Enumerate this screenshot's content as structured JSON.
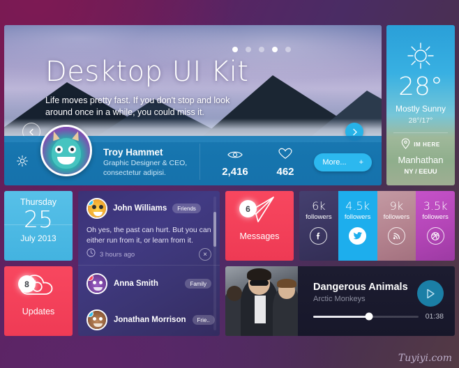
{
  "hero": {
    "title": "Desktop UI Kit",
    "subtitle": "Life moves pretty fast. If you don't stop and look around once in a while, you could miss it.",
    "prev_label": "←",
    "next_label": "→",
    "dots": [
      {
        "active": true
      },
      {
        "active": false
      },
      {
        "active": false
      },
      {
        "active": true
      },
      {
        "active": false
      }
    ],
    "profile": {
      "name": "Troy Hammet",
      "role_line1": "Graphic Designer & CEO,",
      "role_line2": "consectetur adipisi.",
      "views": "2,416",
      "likes": "462",
      "more_label": "More...",
      "more_plus": "+",
      "settings_icon": "gear-icon",
      "views_icon": "eye-icon",
      "likes_icon": "heart-icon"
    }
  },
  "weather": {
    "icon": "sun-icon",
    "temperature": "28°",
    "condition": "Mostly Sunny",
    "range": "28°/17°",
    "here_label": "IM HERE",
    "city": "Manhathan",
    "region": "NY / EEUU",
    "pin_icon": "location-pin-icon"
  },
  "calendar": {
    "weekday": "Thursday",
    "day": "25",
    "month_year": "July 2013"
  },
  "updates": {
    "badge": "8",
    "label": "Updates",
    "icon": "cloud-refresh-icon"
  },
  "messages": {
    "badge": "6",
    "label": "Messages",
    "icon": "paper-plane-icon"
  },
  "chat": {
    "featured": {
      "name": "John Williams",
      "tag": "Friends",
      "text": "Oh yes, the past can hurt. But you can either run from it, or learn from it.",
      "time": "3 hours ago",
      "time_icon": "clock-icon",
      "close_label": "×",
      "status_color": "#2ec0f0"
    },
    "rows": [
      {
        "name": "Anna Smith",
        "tag": "Family",
        "status_color": "#f8475f"
      },
      {
        "name": "Jonathan Morrison",
        "tag": "Frie..",
        "status_color": "#2ec0f0"
      }
    ]
  },
  "social": [
    {
      "count": "6k",
      "label": "followers",
      "icon": "facebook-icon",
      "glyph": "f",
      "bg": "#3b3a63",
      "filled": false
    },
    {
      "count": "4.5k",
      "label": "followers",
      "icon": "twitter-icon",
      "glyph": "✈",
      "bg": "#1daeed",
      "filled": true
    },
    {
      "count": "9k",
      "label": "followers",
      "icon": "rss-icon",
      "glyph": "●",
      "bg": "#b08490",
      "filled": false
    },
    {
      "count": "3.5k",
      "label": "followers",
      "icon": "dribbble-icon",
      "glyph": "◎",
      "bg": "#b848b8",
      "filled": false
    }
  ],
  "player": {
    "title": "Dangerous Animals",
    "artist": "Arctic Monkeys",
    "time": "01:38",
    "play_icon": "play-icon",
    "progress_percent": 53
  },
  "watermark": "Tuyiyi.com"
}
